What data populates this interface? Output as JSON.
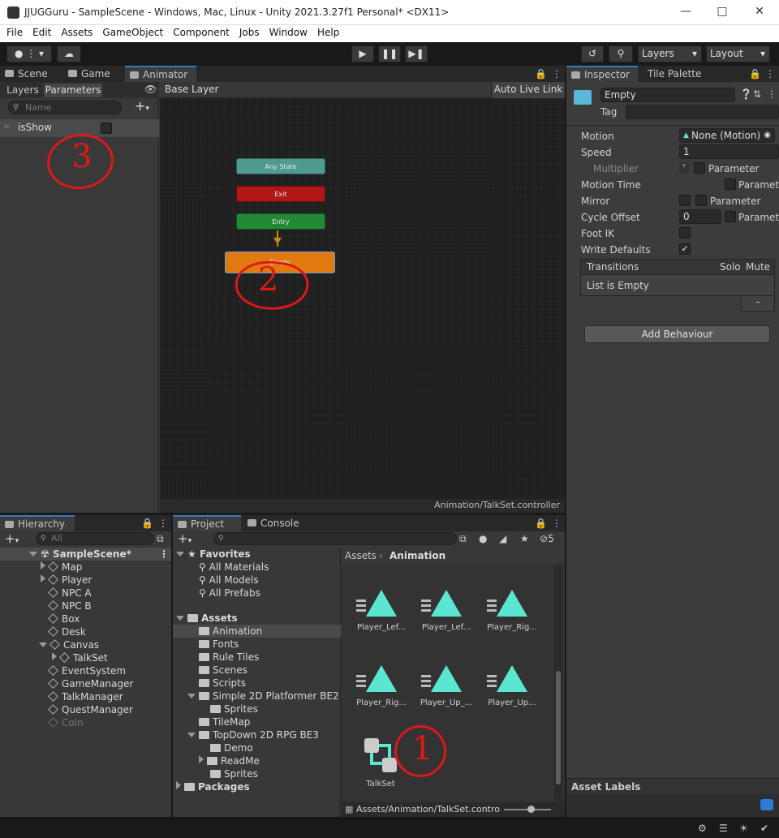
{
  "window": {
    "title": "JJUGGuru - SampleScene - Windows, Mac, Linux - Unity 2021.3.27f1 Personal* <DX11>"
  },
  "menu": [
    "File",
    "Edit",
    "Assets",
    "GameObject",
    "Component",
    "Jobs",
    "Window",
    "Help"
  ],
  "toolbar": {
    "layers_label": "Layers",
    "layout_label": "Layout"
  },
  "animator": {
    "tabs": [
      "Scene",
      "Game",
      "Animator"
    ],
    "subtabs": [
      "Layers",
      "Parameters"
    ],
    "search_placeholder": "Name",
    "breadcrumb": "Base Layer",
    "auto_live_link": "Auto Live Link",
    "parameter": "isShow",
    "nodes": {
      "any": "Any State",
      "exit": "Exit",
      "entry": "Entry",
      "empty": "Empty"
    },
    "footer_path": "Animation/TalkSet.controller"
  },
  "inspector": {
    "tabs": [
      "Inspector",
      "Tile Palette"
    ],
    "name": "Empty",
    "tag_label": "Tag",
    "motion_label": "Motion",
    "motion_value": "None (Motion)",
    "speed_label": "Speed",
    "speed_value": "1",
    "multiplier_label": "Multiplier",
    "parameter_label": "Parameter",
    "motion_time_label": "Motion Time",
    "mirror_label": "Mirror",
    "cycle_offset_label": "Cycle Offset",
    "cycle_offset_value": "0",
    "foot_ik_label": "Foot IK",
    "write_defaults_label": "Write Defaults",
    "transitions_label": "Transitions",
    "solo_label": "Solo",
    "mute_label": "Mute",
    "list_empty": "List is Empty",
    "minus": "–",
    "add_behaviour": "Add Behaviour",
    "asset_labels": "Asset Labels"
  },
  "hierarchy": {
    "tab": "Hierarchy",
    "search_placeholder": "All",
    "scene": "SampleScene*",
    "items": [
      "Map",
      "Player",
      "NPC A",
      "NPC B",
      "Box",
      "Desk",
      "Canvas",
      "TalkSet",
      "EventSystem",
      "GameManager",
      "TalkManager",
      "QuestManager",
      "Coin"
    ]
  },
  "project": {
    "tabs": [
      "Project",
      "Console"
    ],
    "hidden_count": "5",
    "favorites": "Favorites",
    "fav_items": [
      "All Materials",
      "All Models",
      "All Prefabs"
    ],
    "assets": "Assets",
    "tree": [
      "Animation",
      "Fonts",
      "Rule Tiles",
      "Scenes",
      "Scripts",
      "Simple 2D Platformer BE2",
      "Sprites",
      "TileMap",
      "TopDown 2D RPG BE3",
      "Demo",
      "ReadMe",
      "Sprites"
    ],
    "packages": "Packages",
    "breadcrumb_root": "Assets",
    "breadcrumb_current": "Animation",
    "grid_items": [
      "Player_Lef...",
      "Player_Lef...",
      "Player_Rig...",
      "Player_Rig...",
      "Player_Up_...",
      "Player_Up..."
    ],
    "controller": "TalkSet",
    "footer_path": "Assets/Animation/TalkSet.contro"
  },
  "annotations": [
    "3",
    "2",
    "1"
  ],
  "colors": {
    "accent": "#3a79bb",
    "any_state": "#4f9b90",
    "exit": "#b01818",
    "entry": "#238a34",
    "empty_state": "#e07a10",
    "asset_tri": "#5ce6d2",
    "annotation": "#e01818"
  }
}
